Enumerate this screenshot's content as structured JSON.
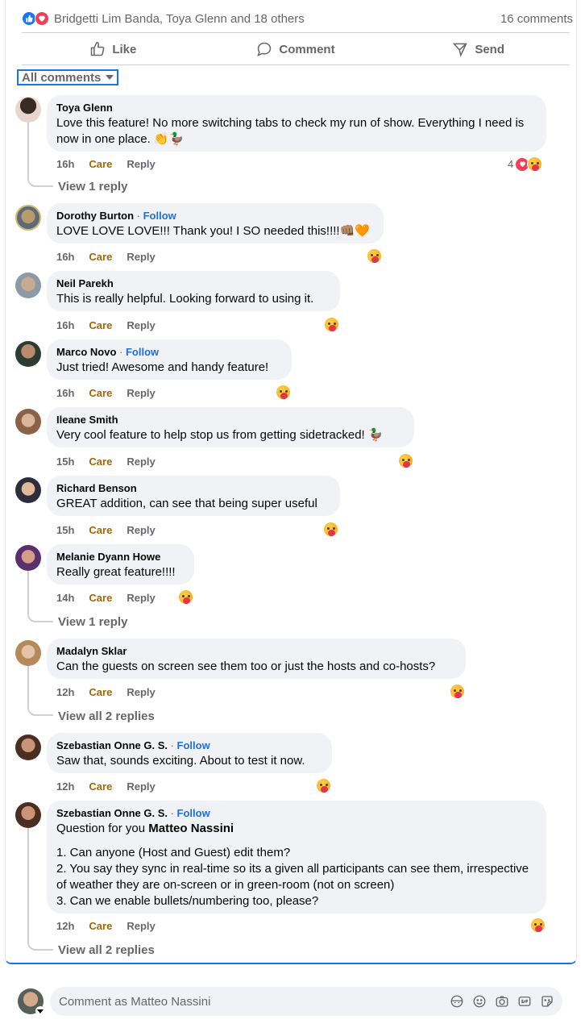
{
  "summary": {
    "names": "Bridgetti Lim Banda, Toya Glenn and 18 others",
    "comment_count": "16 comments"
  },
  "actions": {
    "like": "Like",
    "comment": "Comment",
    "send": "Send"
  },
  "filter": {
    "label": "All comments"
  },
  "comments": [
    {
      "author": "Toya Glenn",
      "follow": "",
      "text": "Love this feature! No more switching tabs to check my run of show. Everything I need is now in one place. 👏🦆",
      "time": "16h",
      "care": "Care",
      "reply": "Reply",
      "reaction_count": "4",
      "view_replies": "View 1 reply"
    },
    {
      "author": "Dorothy Burton",
      "follow": "Follow",
      "text": "LOVE LOVE LOVE!!! Thank you! I SO needed this!!!!👊🏽🧡",
      "time": "16h",
      "care": "Care",
      "reply": "Reply"
    },
    {
      "author": "Neil Parekh",
      "follow": "",
      "text": "This is really helpful. Looking forward to using it.",
      "time": "16h",
      "care": "Care",
      "reply": "Reply"
    },
    {
      "author": "Marco Novo",
      "follow": "Follow",
      "text": "Just tried! Awesome and handy feature!",
      "time": "16h",
      "care": "Care",
      "reply": "Reply"
    },
    {
      "author": "Ileane Smith",
      "follow": "",
      "text": "Very cool feature to help stop us from getting sidetracked! 🦆",
      "time": "15h",
      "care": "Care",
      "reply": "Reply"
    },
    {
      "author": "Richard Benson",
      "follow": "",
      "text": "GREAT addition, can see that being super useful",
      "time": "15h",
      "care": "Care",
      "reply": "Reply"
    },
    {
      "author": "Melanie Dyann Howe",
      "follow": "",
      "text": "Really great feature!!!!",
      "time": "14h",
      "care": "Care",
      "reply": "Reply",
      "view_replies": "View 1 reply"
    },
    {
      "author": "Madalyn Sklar",
      "follow": "",
      "text": "Can the guests on screen see them too or just the hosts and co-hosts?",
      "time": "12h",
      "care": "Care",
      "reply": "Reply",
      "view_replies": "View all 2 replies"
    },
    {
      "author": "Szebastian Onne G. S.",
      "follow": "Follow",
      "text": "Saw that, sounds exciting. About to test it now.",
      "time": "12h",
      "care": "Care",
      "reply": "Reply"
    },
    {
      "author": "Szebastian Onne G. S.",
      "follow": "Follow",
      "text_prefix": "Question for you ",
      "mention": "Matteo Nassini",
      "lines": [
        "1. Can anyone (Host and Guest) edit them?",
        "2. You say they sync in real-time so its a given all participants can see them, irrespective of weather they are on-screen or in green-room (not on screen)",
        "3. Can we enable bullets/numbering too, please?"
      ],
      "time": "12h",
      "care": "Care",
      "reply": "Reply",
      "view_replies": "View all 2 replies"
    }
  ],
  "composer": {
    "placeholder": "Comment as Matteo Nassini"
  },
  "colors": {
    "accent": "#1b74e4",
    "care": "#a16800",
    "bubble": "#f0f2f5",
    "muted": "#65676b"
  }
}
